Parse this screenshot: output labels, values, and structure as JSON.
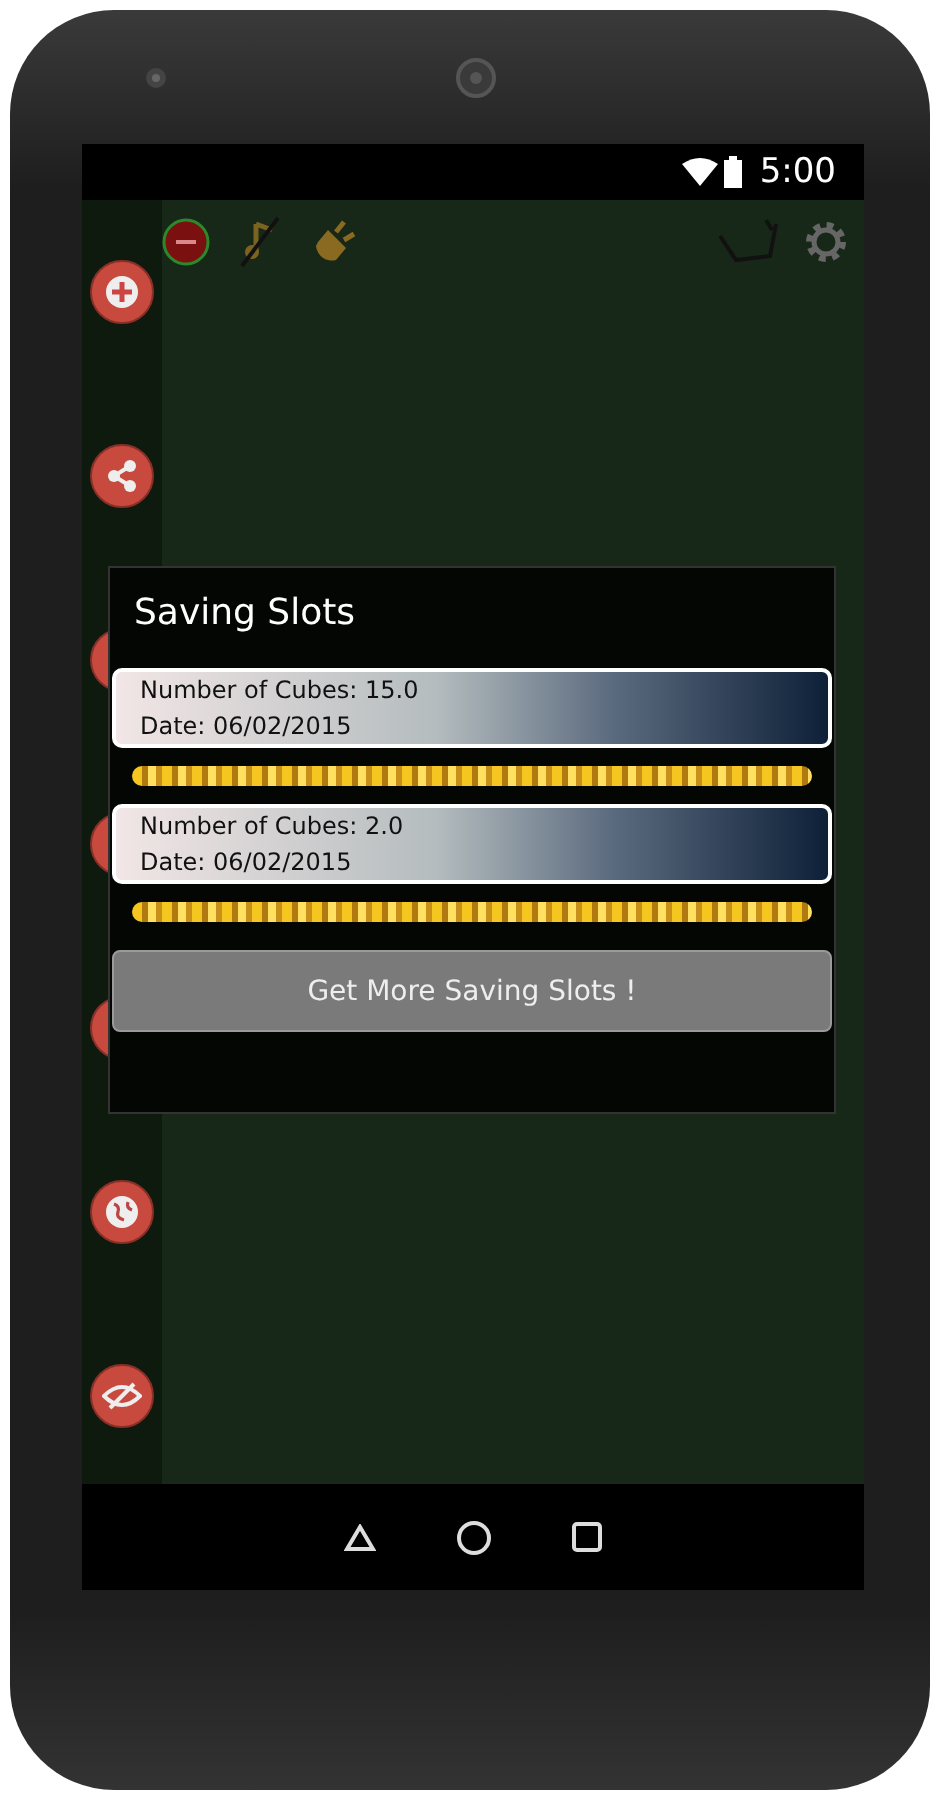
{
  "status_bar": {
    "time": "5:00"
  },
  "toolbar": {
    "left_icons": [
      {
        "kind": "record"
      },
      {
        "kind": "music-off"
      },
      {
        "kind": "plug"
      }
    ],
    "right_icons": [
      {
        "kind": "chain"
      },
      {
        "kind": "gear"
      }
    ]
  },
  "sidebar": {
    "buttons": [
      {
        "kind": "add"
      },
      {
        "kind": "share"
      },
      {
        "kind": "plain"
      },
      {
        "kind": "plain"
      },
      {
        "kind": "plain"
      },
      {
        "kind": "globe"
      },
      {
        "kind": "eye-off"
      }
    ]
  },
  "dialog": {
    "title": "Saving Slots",
    "slots": [
      {
        "cubes": "Number of Cubes: 15.0",
        "date": "Date: 06/02/2015"
      },
      {
        "cubes": "Number of Cubes: 2.0",
        "date": "Date: 06/02/2015"
      }
    ],
    "button": "Get More Saving Slots !"
  },
  "nav_bar": {
    "buttons": [
      {
        "kind": "back"
      },
      {
        "kind": "home"
      },
      {
        "kind": "recents"
      }
    ]
  }
}
